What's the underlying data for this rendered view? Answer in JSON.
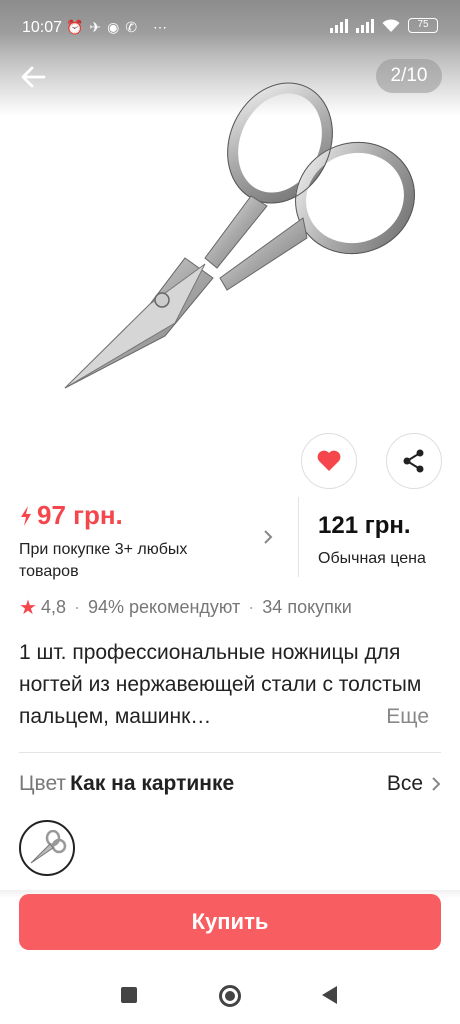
{
  "status_bar": {
    "time": "10:07",
    "left_icons": [
      "alarm-icon",
      "telegram-icon",
      "messenger-icon",
      "whatsapp-icon",
      "more-icon"
    ],
    "battery": "75"
  },
  "gallery": {
    "pager": "2/10"
  },
  "price": {
    "sale_price": "97 грн.",
    "sale_note": "При покупке 3+ любых товаров",
    "regular_price": "121 грн.",
    "regular_note": "Обычная цена",
    "accent_color": "#f5474b"
  },
  "rating": {
    "score": "4,8",
    "recommend": "94% рекомендуют",
    "purchases": "34 покупки"
  },
  "product": {
    "title": "1 шт. профессиональные ножницы для ногтей из нержавеющей стали с толстым пальцем, машинк…",
    "more": "Еще"
  },
  "color": {
    "label": "Цвет",
    "value": "Как на картинке",
    "all": "Все"
  },
  "buy": {
    "label": "Купить",
    "color": "#f75d61"
  }
}
